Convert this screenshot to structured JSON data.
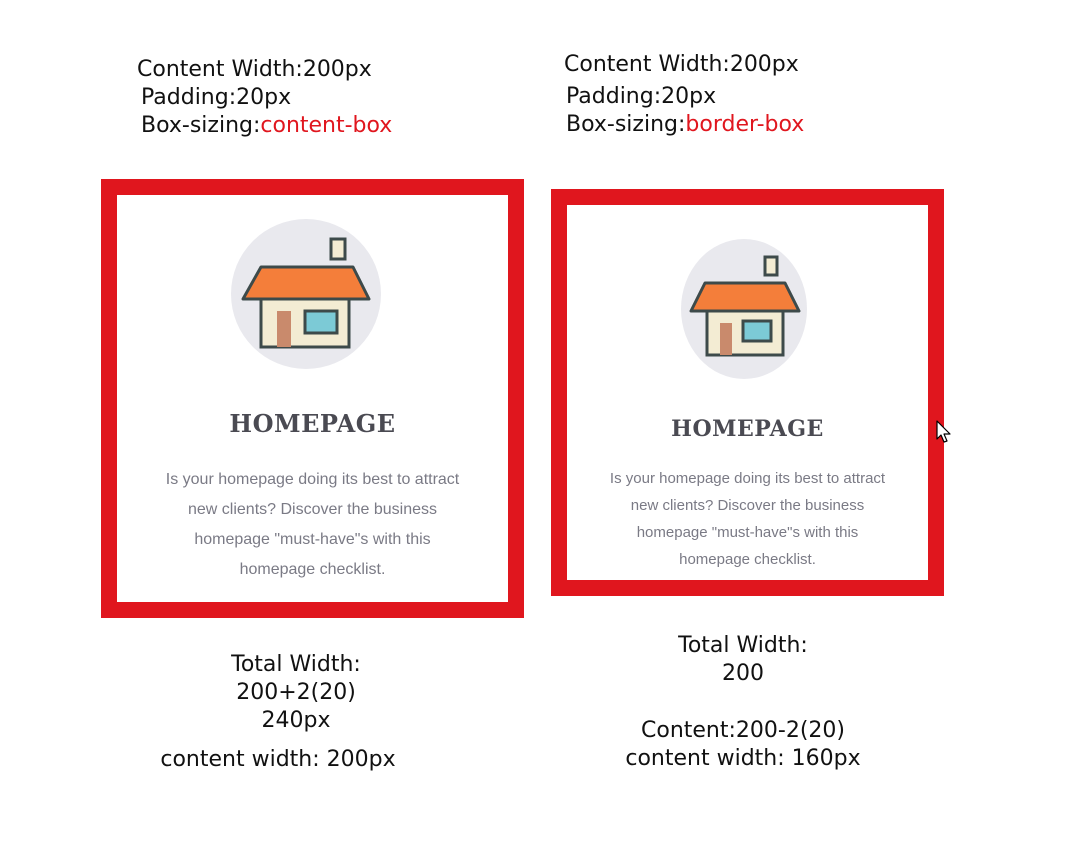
{
  "left": {
    "header": {
      "content_width": "Content Width:200px",
      "padding": "Padding:20px",
      "box_sizing_label": "Box-sizing:",
      "box_sizing_value": "content-box"
    },
    "card": {
      "icon": "house-icon",
      "title": "HOMEPAGE",
      "text_lines": [
        "Is your homepage doing its best to attract",
        "new clients? Discover the business",
        "homepage \"must-have\"s with this",
        "homepage checklist."
      ]
    },
    "footer": {
      "line1": "Total Width:",
      "line2": "200+2(20)",
      "line3": "240px",
      "line4": "content width: 200px"
    }
  },
  "right": {
    "header": {
      "content_width": "Content Width:200px",
      "padding": "Padding:20px",
      "box_sizing_label": "Box-sizing:",
      "box_sizing_value": "border-box"
    },
    "card": {
      "icon": "house-icon",
      "title": "HOMEPAGE",
      "text_lines": [
        "Is your homepage doing its best to attract",
        "new clients? Discover the business",
        "homepage \"must-have\"s with this",
        "homepage checklist."
      ]
    },
    "footer": {
      "line1": "Total Width:",
      "line2": "200",
      "line3": "Content:200-2(20)",
      "line4": "content width: 160px"
    }
  },
  "colors": {
    "accent": "#e0161e",
    "roof": "#f47e3a",
    "wall": "#f3ecd3",
    "window": "#7ccad6",
    "door": "#c98a6c",
    "icon_bg": "#e9e9ee"
  }
}
